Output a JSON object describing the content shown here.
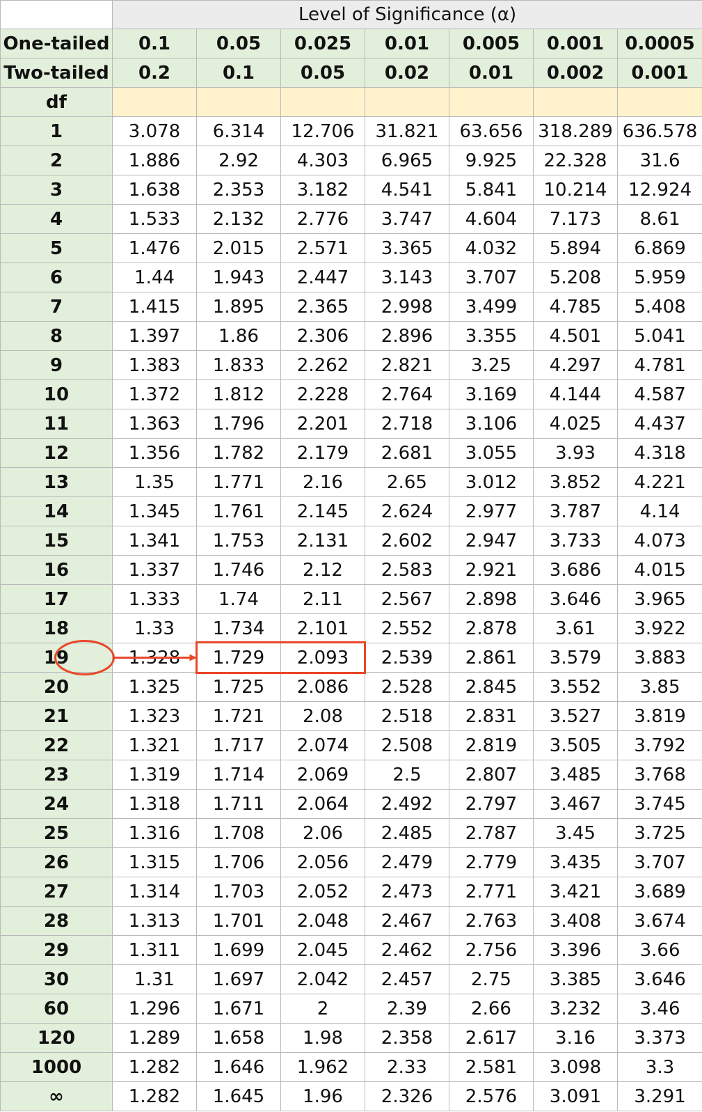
{
  "table": {
    "level_label": "Level of Significance (α)",
    "one_tailed_label": "One-tailed",
    "two_tailed_label": "Two-tailed",
    "df_label": "df",
    "one_tailed": [
      "0.1",
      "0.05",
      "0.025",
      "0.01",
      "0.005",
      "0.001",
      "0.0005"
    ],
    "two_tailed": [
      "0.2",
      "0.1",
      "0.05",
      "0.02",
      "0.01",
      "0.002",
      "0.001"
    ],
    "rows": [
      {
        "df": "1",
        "values": [
          "3.078",
          "6.314",
          "12.706",
          "31.821",
          "63.656",
          "318.289",
          "636.578"
        ]
      },
      {
        "df": "2",
        "values": [
          "1.886",
          "2.92",
          "4.303",
          "6.965",
          "9.925",
          "22.328",
          "31.6"
        ]
      },
      {
        "df": "3",
        "values": [
          "1.638",
          "2.353",
          "3.182",
          "4.541",
          "5.841",
          "10.214",
          "12.924"
        ]
      },
      {
        "df": "4",
        "values": [
          "1.533",
          "2.132",
          "2.776",
          "3.747",
          "4.604",
          "7.173",
          "8.61"
        ]
      },
      {
        "df": "5",
        "values": [
          "1.476",
          "2.015",
          "2.571",
          "3.365",
          "4.032",
          "5.894",
          "6.869"
        ]
      },
      {
        "df": "6",
        "values": [
          "1.44",
          "1.943",
          "2.447",
          "3.143",
          "3.707",
          "5.208",
          "5.959"
        ]
      },
      {
        "df": "7",
        "values": [
          "1.415",
          "1.895",
          "2.365",
          "2.998",
          "3.499",
          "4.785",
          "5.408"
        ]
      },
      {
        "df": "8",
        "values": [
          "1.397",
          "1.86",
          "2.306",
          "2.896",
          "3.355",
          "4.501",
          "5.041"
        ]
      },
      {
        "df": "9",
        "values": [
          "1.383",
          "1.833",
          "2.262",
          "2.821",
          "3.25",
          "4.297",
          "4.781"
        ]
      },
      {
        "df": "10",
        "values": [
          "1.372",
          "1.812",
          "2.228",
          "2.764",
          "3.169",
          "4.144",
          "4.587"
        ]
      },
      {
        "df": "11",
        "values": [
          "1.363",
          "1.796",
          "2.201",
          "2.718",
          "3.106",
          "4.025",
          "4.437"
        ]
      },
      {
        "df": "12",
        "values": [
          "1.356",
          "1.782",
          "2.179",
          "2.681",
          "3.055",
          "3.93",
          "4.318"
        ]
      },
      {
        "df": "13",
        "values": [
          "1.35",
          "1.771",
          "2.16",
          "2.65",
          "3.012",
          "3.852",
          "4.221"
        ]
      },
      {
        "df": "14",
        "values": [
          "1.345",
          "1.761",
          "2.145",
          "2.624",
          "2.977",
          "3.787",
          "4.14"
        ]
      },
      {
        "df": "15",
        "values": [
          "1.341",
          "1.753",
          "2.131",
          "2.602",
          "2.947",
          "3.733",
          "4.073"
        ]
      },
      {
        "df": "16",
        "values": [
          "1.337",
          "1.746",
          "2.12",
          "2.583",
          "2.921",
          "3.686",
          "4.015"
        ]
      },
      {
        "df": "17",
        "values": [
          "1.333",
          "1.74",
          "2.11",
          "2.567",
          "2.898",
          "3.646",
          "3.965"
        ]
      },
      {
        "df": "18",
        "values": [
          "1.33",
          "1.734",
          "2.101",
          "2.552",
          "2.878",
          "3.61",
          "3.922"
        ]
      },
      {
        "df": "19",
        "values": [
          "1.328",
          "1.729",
          "2.093",
          "2.539",
          "2.861",
          "3.579",
          "3.883"
        ]
      },
      {
        "df": "20",
        "values": [
          "1.325",
          "1.725",
          "2.086",
          "2.528",
          "2.845",
          "3.552",
          "3.85"
        ]
      },
      {
        "df": "21",
        "values": [
          "1.323",
          "1.721",
          "2.08",
          "2.518",
          "2.831",
          "3.527",
          "3.819"
        ]
      },
      {
        "df": "22",
        "values": [
          "1.321",
          "1.717",
          "2.074",
          "2.508",
          "2.819",
          "3.505",
          "3.792"
        ]
      },
      {
        "df": "23",
        "values": [
          "1.319",
          "1.714",
          "2.069",
          "2.5",
          "2.807",
          "3.485",
          "3.768"
        ]
      },
      {
        "df": "24",
        "values": [
          "1.318",
          "1.711",
          "2.064",
          "2.492",
          "2.797",
          "3.467",
          "3.745"
        ]
      },
      {
        "df": "25",
        "values": [
          "1.316",
          "1.708",
          "2.06",
          "2.485",
          "2.787",
          "3.45",
          "3.725"
        ]
      },
      {
        "df": "26",
        "values": [
          "1.315",
          "1.706",
          "2.056",
          "2.479",
          "2.779",
          "3.435",
          "3.707"
        ]
      },
      {
        "df": "27",
        "values": [
          "1.314",
          "1.703",
          "2.052",
          "2.473",
          "2.771",
          "3.421",
          "3.689"
        ]
      },
      {
        "df": "28",
        "values": [
          "1.313",
          "1.701",
          "2.048",
          "2.467",
          "2.763",
          "3.408",
          "3.674"
        ]
      },
      {
        "df": "29",
        "values": [
          "1.311",
          "1.699",
          "2.045",
          "2.462",
          "2.756",
          "3.396",
          "3.66"
        ]
      },
      {
        "df": "30",
        "values": [
          "1.31",
          "1.697",
          "2.042",
          "2.457",
          "2.75",
          "3.385",
          "3.646"
        ]
      },
      {
        "df": "60",
        "values": [
          "1.296",
          "1.671",
          "2",
          "2.39",
          "2.66",
          "3.232",
          "3.46"
        ]
      },
      {
        "df": "120",
        "values": [
          "1.289",
          "1.658",
          "1.98",
          "2.358",
          "2.617",
          "3.16",
          "3.373"
        ]
      },
      {
        "df": "1000",
        "values": [
          "1.282",
          "1.646",
          "1.962",
          "2.33",
          "2.581",
          "3.098",
          "3.3"
        ]
      },
      {
        "df": "∞",
        "values": [
          "1.282",
          "1.645",
          "1.96",
          "2.326",
          "2.576",
          "3.091",
          "3.291"
        ]
      }
    ]
  },
  "highlight": {
    "df": "19",
    "columns": [
      "0.05",
      "0.025"
    ],
    "color": "#e8472a"
  },
  "colors": {
    "header_green": "#e2efda",
    "df_yellow": "#fff2cc",
    "title_gray": "#ececec",
    "border": "#b9b9b9"
  }
}
